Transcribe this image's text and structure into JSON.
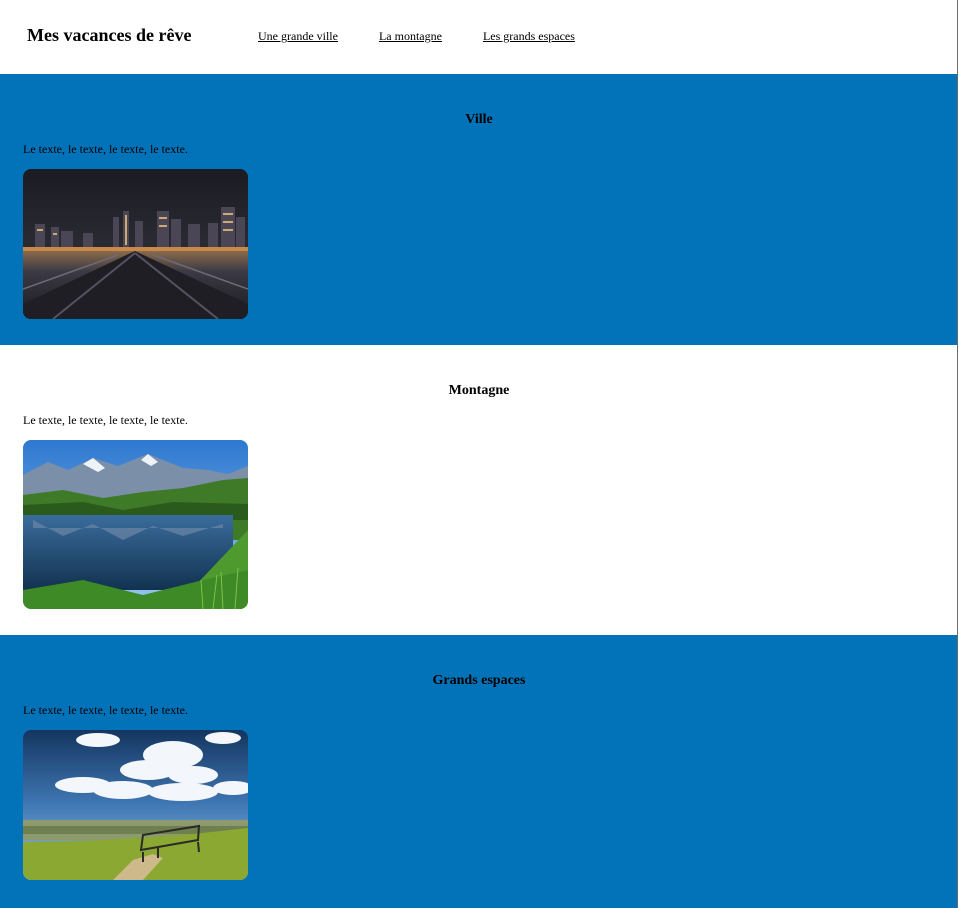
{
  "header": {
    "site_title": "Mes vacances de rêve",
    "nav": [
      {
        "label": "Une grande ville"
      },
      {
        "label": "La montagne"
      },
      {
        "label": "Les grands espaces"
      }
    ]
  },
  "sections": [
    {
      "title": "Ville",
      "text": "Le texte, le texte, le texte, le texte.",
      "image": "city-night-skyline-photo",
      "background": "#0373b9"
    },
    {
      "title": "Montagne",
      "text": "Le texte, le texte, le texte, le texte.",
      "image": "mountain-lake-reflection-photo",
      "background": "#ffffff"
    },
    {
      "title": "Grands espaces",
      "text": "Le texte, le texte, le texte, le texte.",
      "image": "hill-bench-sky-photo",
      "background": "#0373b9"
    }
  ]
}
